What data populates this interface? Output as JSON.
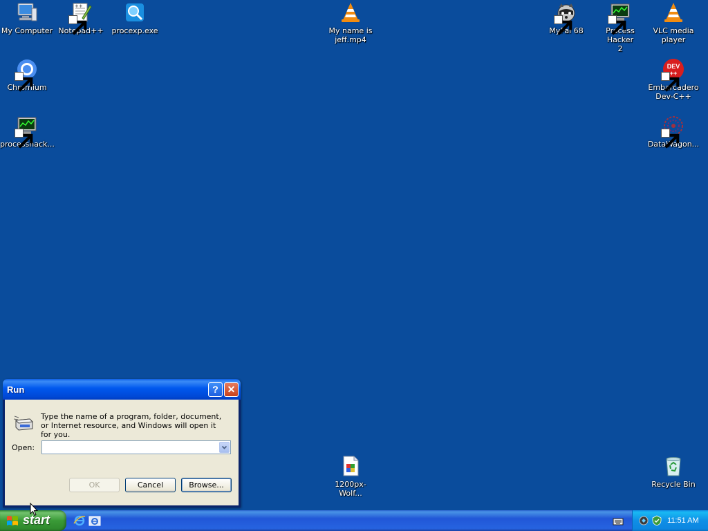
{
  "desktop": {
    "icons": {
      "my_computer": "My Computer",
      "notepadpp": "Notepad++",
      "procexp": "procexp.exe",
      "jeff_video": "My name is\njeff.mp4",
      "mypal": "MyPal 68",
      "process_hacker": "Process Hacker\n2",
      "vlc": "VLC media\nplayer",
      "chromium": "Chromium",
      "devcpp": "Embarcadero\nDev-C++",
      "processhacker_short": "processhack...",
      "datawagon": "DataWagon...",
      "wolf_image": "1200px-Wolf...",
      "recycle_bin": "Recycle Bin"
    },
    "background_color": "#0a4c9c"
  },
  "run_dialog": {
    "title": "Run",
    "help_glyph": "?",
    "close_glyph": "✕",
    "message": "Type the name of a program, folder, document, or Internet resource, and Windows will open it for you.",
    "open_label": "Open:",
    "open_value": "",
    "ok_label": "OK",
    "cancel_label": "Cancel",
    "browse_label": "Browse..."
  },
  "taskbar": {
    "start_label": "start",
    "clock": "11:51 AM",
    "quick_launch": [
      "internet-explorer-icon",
      "show-desktop-icon"
    ]
  }
}
